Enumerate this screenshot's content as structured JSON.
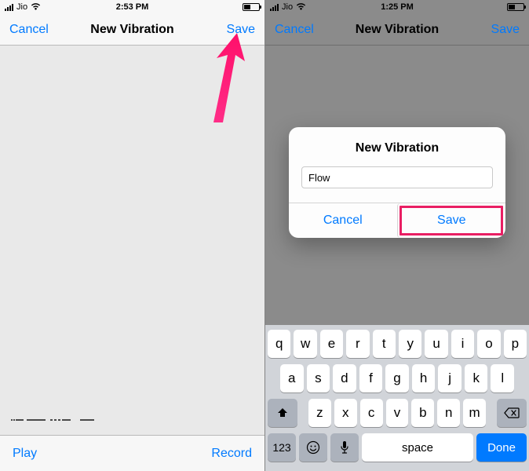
{
  "colors": {
    "accent": "#007aff",
    "highlight": "#e91e63"
  },
  "screen1": {
    "status": {
      "carrier": "Jio",
      "wifi_icon": "wifi",
      "time": "2:53 PM"
    },
    "nav": {
      "left": "Cancel",
      "title": "New Vibration",
      "right": "Save"
    },
    "toolbar": {
      "play": "Play",
      "record": "Record"
    }
  },
  "screen2": {
    "status": {
      "carrier": "Jio",
      "wifi_icon": "wifi",
      "time": "1:25 PM"
    },
    "nav": {
      "left": "Cancel",
      "title": "New Vibration",
      "right": "Save"
    },
    "alert": {
      "title": "New Vibration",
      "input_value": "Flow",
      "cancel": "Cancel",
      "save": "Save"
    },
    "keyboard": {
      "row1": [
        "q",
        "w",
        "e",
        "r",
        "t",
        "y",
        "u",
        "i",
        "o",
        "p"
      ],
      "row2": [
        "a",
        "s",
        "d",
        "f",
        "g",
        "h",
        "j",
        "k",
        "l"
      ],
      "row3": [
        "z",
        "x",
        "c",
        "v",
        "b",
        "n",
        "m"
      ],
      "key_123": "123",
      "space": "space",
      "done": "Done"
    }
  }
}
